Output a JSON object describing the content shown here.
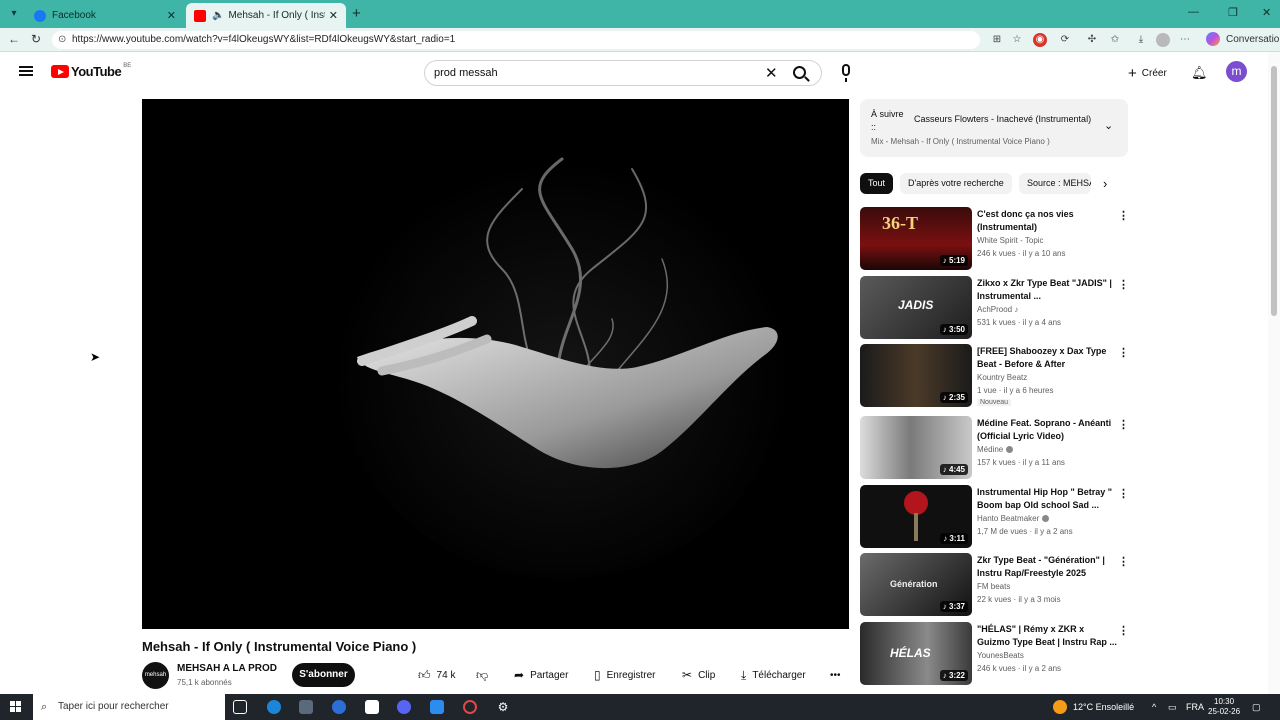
{
  "browser": {
    "tabs": [
      {
        "title": "Facebook",
        "close": "✕"
      },
      {
        "title": "Mehsah - If Only ( Instrumental",
        "close": "✕"
      }
    ],
    "new_tab": "+",
    "window_controls": {
      "minimize": "—",
      "maximize": "❐",
      "close": "✕"
    },
    "url": "https://www.youtube.com/watch?v=f4lOkeugsWY&list=RDf4lOkeugsWY&start_radio=1",
    "copilot_label": "Conversation"
  },
  "youtube": {
    "logo_text": "YouTube",
    "country_code": "BE",
    "search": {
      "value": "prod messah",
      "clear": "✕"
    },
    "create_label": "Créer",
    "avatar_letter": "m"
  },
  "video": {
    "title": "Mehsah - If Only ( Instrumental Voice Piano )",
    "channel": {
      "name": "MEHSAH A LA PROD",
      "subscribers": "75,1 k abonnés",
      "avatar_text": "mehsah"
    },
    "subscribe_label": "S'abonner",
    "actions": {
      "likes": "74 k",
      "share": "Partager",
      "save": "Enregistrer",
      "clip": "Clip",
      "download": "Télécharger",
      "more": "•••"
    }
  },
  "up_next": {
    "label": "À suivre ::",
    "title": "Casseurs Flowters - Inachevé (Instrumental)",
    "mix": "Mix - Mehsah - If Only ( Instrumental Voice Piano )"
  },
  "chips": [
    "Tout",
    "D'après votre recherche",
    "Source : MEHSAH"
  ],
  "recommendations": [
    {
      "title": "C'est donc ça nos vies (Instrumental)",
      "channel": "White Spirit - Topic",
      "meta": "246 k vues · il y a 10 ans",
      "duration": "♪ 5:19",
      "badge": "",
      "verified": false,
      "thumb_text": "36-T"
    },
    {
      "title": "Zikxo x Zkr Type Beat \"JADIS\" | Instrumental ...",
      "channel": "AchProod ♪",
      "meta": "531 k vues · il y a 4 ans",
      "duration": "♪ 3:50",
      "badge": "",
      "verified": false,
      "thumb_text": "JADIS"
    },
    {
      "title": "[FREE] Shaboozey x Dax Type Beat - Before & After",
      "channel": "Kountry Beatz",
      "meta": "1 vue · il y a 6 heures",
      "duration": "♪ 2:35",
      "badge": "Nouveau",
      "verified": false,
      "thumb_text": ""
    },
    {
      "title": "Médine Feat. Soprano - Anéanti (Official Lyric Video)",
      "channel": "Médine",
      "meta": "157 k vues · il y a 11 ans",
      "duration": "♪ 4:45",
      "badge": "",
      "verified": true,
      "thumb_text": ""
    },
    {
      "title": "Instrumental Hip Hop \" Betray \" Boom bap Old school Sad ...",
      "channel": "Hanto Beatmaker",
      "meta": "1,7 M de vues · il y a 2 ans",
      "duration": "♪ 3:11",
      "badge": "",
      "verified": true,
      "thumb_text": ""
    },
    {
      "title": "Zkr Type Beat - \"Génération\" | Instru Rap/Freestyle 2025",
      "channel": "FM beats",
      "meta": "22 k vues · il y a 3 mois",
      "duration": "♪ 3:37",
      "badge": "",
      "verified": false,
      "thumb_text": "Génération"
    },
    {
      "title": "\"HÉLAS\" | Rémy x ZKR x Guizmo Type Beat | Instru Rap ...",
      "channel": "YounesBeats",
      "meta": "246 k vues · il y a 2 ans",
      "duration": "♪ 3:22",
      "badge": "",
      "verified": false,
      "thumb_text": "HÉLAS"
    }
  ],
  "taskbar": {
    "search_placeholder": "Taper ici pour rechercher",
    "weather": "12°C  Ensoleillé",
    "language": "FRA",
    "time": "10:30",
    "date": "25-02-26"
  },
  "colors": {
    "tabbar": "#3fb5a8",
    "youtube_red": "#ff0000",
    "avatar": "#7c4dce"
  }
}
